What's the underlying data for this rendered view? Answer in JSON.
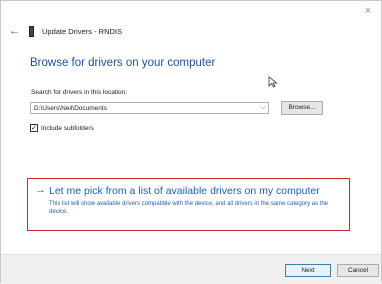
{
  "window": {
    "close_glyph": "×",
    "back_glyph": "←",
    "title": "Update Drivers - RNDIS"
  },
  "main": {
    "heading": "Browse for drivers on your computer",
    "search_label": "Search for drivers in this location:",
    "path_value": "D:\\Users\\Neil\\Documents",
    "dropdown_glyph": "⌵",
    "browse_label": "Browse...",
    "include_subfolders_label": "Include subfolders",
    "include_subfolders_checked": true,
    "checkmark": "✓"
  },
  "pick": {
    "arrow": "→",
    "title": "Let me pick from a list of available drivers on my computer",
    "description": "This list will show available drivers compatible with the device, and all drivers in the same category as the device."
  },
  "footer": {
    "next_label": "Next",
    "cancel_label": "Cancel"
  },
  "colors": {
    "link_blue": "#1f5eb3",
    "heading_blue": "#1f4f9a",
    "highlight_red": "#c8282f"
  },
  "icons": {
    "close": "close-icon",
    "back": "back-arrow-icon",
    "device": "device-icon",
    "cursor": "mouse-cursor-icon",
    "dropdown": "chevron-down-icon",
    "pick_arrow": "arrow-right-icon"
  }
}
